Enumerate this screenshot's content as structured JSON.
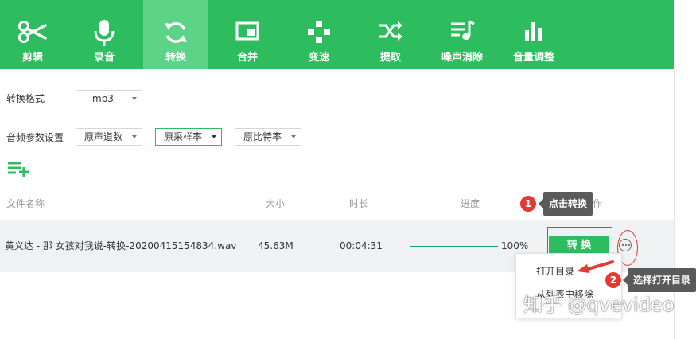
{
  "toolbar": {
    "items": [
      {
        "label": "剪辑",
        "icon": "scissors-icon"
      },
      {
        "label": "录音",
        "icon": "microphone-icon"
      },
      {
        "label": "转换",
        "icon": "convert-icon",
        "active": true
      },
      {
        "label": "合并",
        "icon": "merge-icon"
      },
      {
        "label": "变速",
        "icon": "speed-icon"
      },
      {
        "label": "提取",
        "icon": "extract-icon"
      },
      {
        "label": "噪声消除",
        "icon": "noise-removal-icon"
      },
      {
        "label": "音量调整",
        "icon": "volume-bars-icon"
      }
    ],
    "bg_color": "#2dbd5f",
    "active_color": "#5cd386"
  },
  "form": {
    "format_label": "转换格式",
    "format_value": "mp3",
    "params_label": "音频参数设置",
    "channel_value": "原声道数",
    "samplerate_value": "原采样率",
    "bitrate_value": "原比特率"
  },
  "table": {
    "headers": {
      "name": "文件名称",
      "size": "大小",
      "duration": "时长",
      "progress": "进度",
      "action_partial": "作"
    },
    "rows": [
      {
        "name": "黄义达 - 那 女孩对我说-转换-20200415154834.wav",
        "size": "45.63M",
        "duration": "00:04:31",
        "progress_text": "100%",
        "progress": 1.0,
        "action_label": "转 换"
      }
    ]
  },
  "menu": {
    "items": [
      "打开目录",
      "从列表中移除"
    ]
  },
  "annotations": {
    "step1_number": "1",
    "step1_text": "点击转换",
    "step2_number": "2",
    "step2_text": "选择打开目录",
    "highlight_color": "#e53935"
  },
  "watermark": "知乎 @qvevideo"
}
